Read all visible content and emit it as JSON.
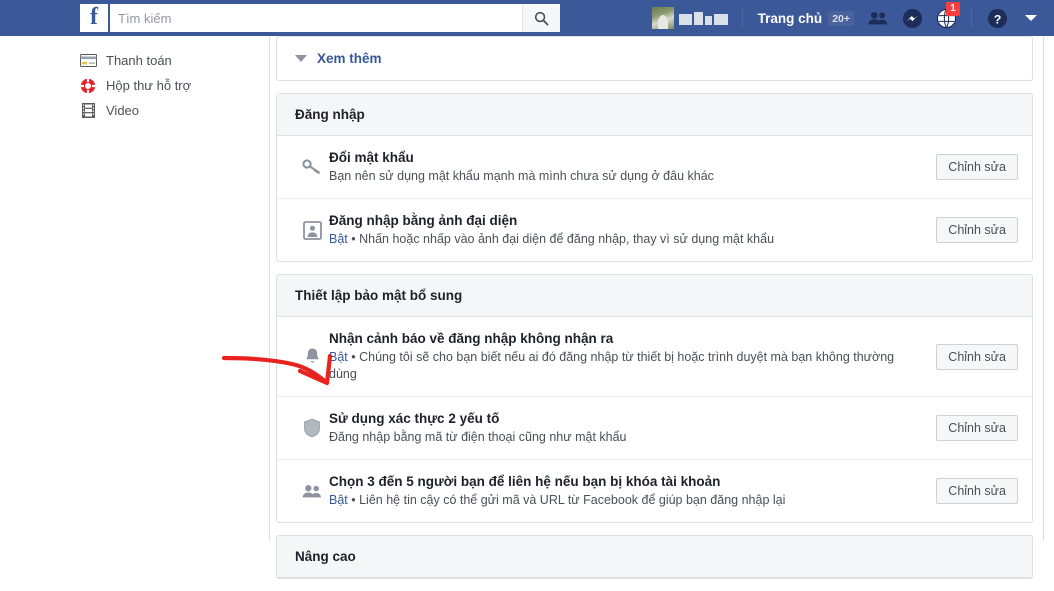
{
  "topbar": {
    "logo_letter": "f",
    "search": {
      "placeholder": "Tìm kiếm",
      "value": "",
      "icon": "search-icon"
    },
    "profile_name_redacted": "",
    "home_label": "Trang chủ",
    "home_badge": "20+",
    "icons": [
      {
        "name": "friend-requests-icon",
        "badge": ""
      },
      {
        "name": "messenger-icon",
        "badge": ""
      },
      {
        "name": "notifications-globe-icon",
        "badge": "1"
      },
      {
        "name": "help-icon",
        "badge": ""
      },
      {
        "name": "account-menu-caret-icon",
        "badge": ""
      }
    ],
    "accent_color": "#3b5998",
    "badge_color": "#fa3e3e"
  },
  "sidebar": {
    "items": [
      {
        "label": "Thanh toán",
        "icon": "credit-card-icon"
      },
      {
        "label": "Hộp thư hỗ trợ",
        "icon": "life-ring-icon"
      },
      {
        "label": "Video",
        "icon": "film-icon"
      }
    ]
  },
  "content": {
    "see_more": {
      "label": "Xem thêm",
      "icon": "chevron-down-icon"
    },
    "edit_label": "Chỉnh sửa",
    "sections": [
      {
        "header": "Đăng nhập",
        "rows": [
          {
            "icon": "key-icon",
            "title": "Đổi mật khẩu",
            "state": "",
            "subtitle": "Bạn nên sử dụng mật khẩu mạnh mà mình chưa sử dụng ở đâu khác",
            "button": "Chỉnh sửa"
          },
          {
            "icon": "profile-picture-icon",
            "title": "Đăng nhập bằng ảnh đại diện",
            "state": "Bật",
            "subtitle": "Nhấn hoặc nhấp vào ảnh đại diện để đăng nhập, thay vì sử dụng mật khẩu",
            "button": "Chỉnh sửa"
          }
        ]
      },
      {
        "header": "Thiết lập bảo mật bổ sung",
        "rows": [
          {
            "icon": "bell-icon",
            "title": "Nhận cảnh báo về đăng nhập không nhận ra",
            "state": "Bật",
            "subtitle": "Chúng tôi sẽ cho bạn biết nếu ai đó đăng nhập từ thiết bị hoặc trình duyệt mà bạn không thường dùng",
            "button": "Chỉnh sửa"
          },
          {
            "icon": "shield-icon",
            "title": "Sử dụng xác thực 2 yếu tố",
            "state": "",
            "subtitle": "Đăng nhập bằng mã từ điện thoại cũng như mật khẩu",
            "button": "Chỉnh sửa"
          },
          {
            "icon": "friends-icon",
            "title": "Chọn 3 đến 5 người bạn để liên hệ nếu bạn bị khóa tài khoản",
            "state": "Bật",
            "subtitle": "Liên hệ tin cậy có thể gửi mã và URL từ Facebook để giúp bạn đăng nhập lại",
            "button": "Chỉnh sửa"
          }
        ]
      },
      {
        "header": "Nâng cao",
        "rows": []
      }
    ]
  },
  "annotation": {
    "name": "red-arrow-annotation",
    "color": "#e8231f"
  }
}
